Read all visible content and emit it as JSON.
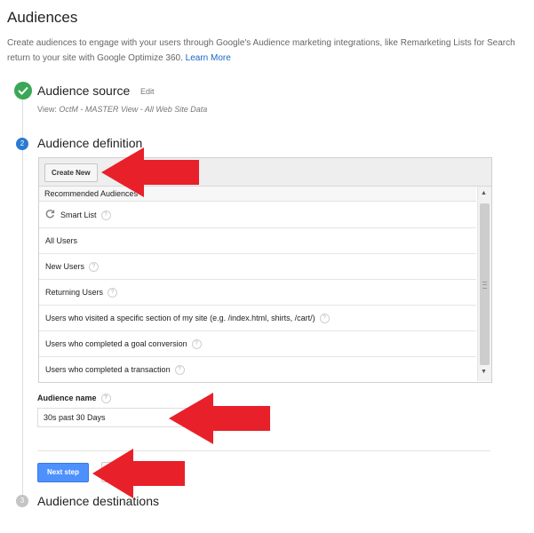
{
  "page": {
    "title": "Audiences",
    "intro_text": "Create audiences to engage with your users through Google's Audience marketing integrations, like Remarketing Lists for Search",
    "intro_text_2": "return to your site with Google Optimize 360.",
    "learn_more": "Learn More"
  },
  "steps": {
    "source": {
      "title": "Audience source",
      "edit": "Edit",
      "view_label": "View:",
      "view_value": "OctM - MASTER View - All Web Site Data"
    },
    "definition": {
      "number": "2",
      "title": "Audience definition"
    },
    "destinations": {
      "number": "3",
      "title": "Audience destinations"
    }
  },
  "audience_panel": {
    "create_button": "Create New",
    "list_header": "Recommended Audiences",
    "items": [
      {
        "label": "Smart List",
        "help": "?"
      },
      {
        "label": "All Users"
      },
      {
        "label": "New Users",
        "help": "?"
      },
      {
        "label": "Returning Users",
        "help": "?"
      },
      {
        "label": "Users who visited a specific section of my site (e.g. /index.html, shirts, /cart/)",
        "help": "?"
      },
      {
        "label": "Users who completed a goal conversion",
        "help": "?"
      },
      {
        "label": "Users who completed a transaction",
        "help": "?"
      }
    ]
  },
  "audience_name": {
    "label": "Audience name",
    "help": "?",
    "value": "30s past 30 Days"
  },
  "buttons": {
    "next_step": "Next step"
  },
  "colors": {
    "accent": "#4d90fe",
    "success": "#3aa757",
    "arrow": "#e8202a"
  }
}
